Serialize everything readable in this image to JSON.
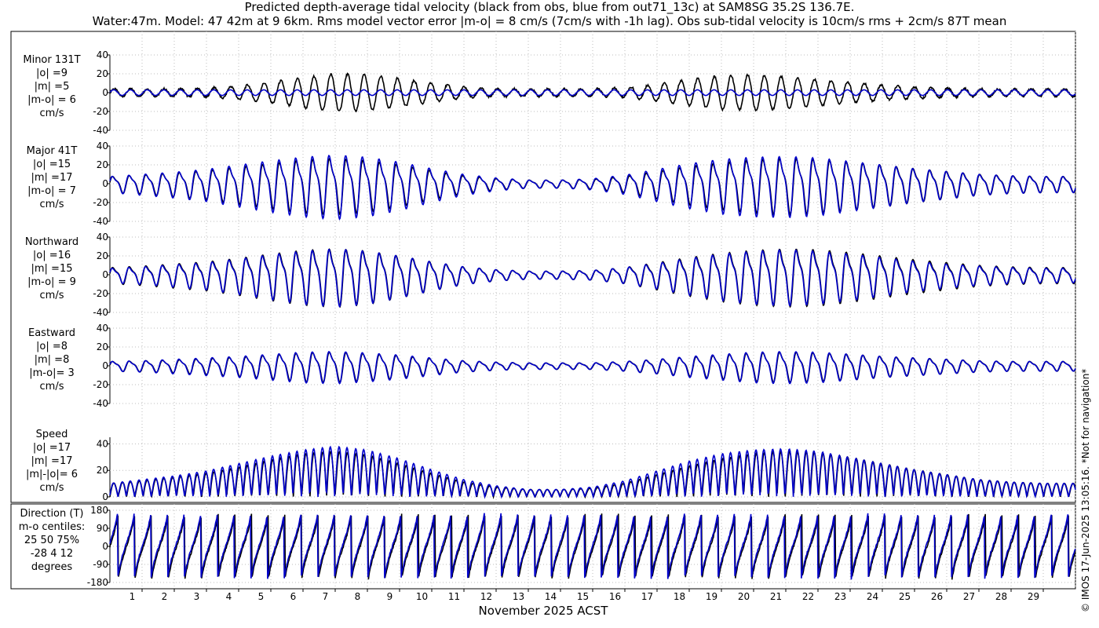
{
  "title_line1": "Predicted depth-average tidal velocity (black from obs, blue from out71_13c) at SAM8SG 35.2S 136.7E.",
  "title_line2": "Water:47m. Model: 47 42m at 9 6km. Rms model vector error |m-o| = 8 cm/s (7cm/s with -1h lag). Obs sub-tidal velocity is 10cm/s rms + 2cm/s 87T mean",
  "footer": "© IMOS 17-Jun-2025 13:05:16. *Not for navigation*",
  "xlabel": "November 2025 ACST",
  "colors": {
    "obs": "#000000",
    "model": "#0000cc",
    "grid": "#bdbdbd"
  },
  "chart_data": [
    {
      "type": "line",
      "panel": "minor",
      "labels": [
        "Minor 131T",
        "|o| =9",
        "|m| =5",
        "|m-o| = 6",
        "cm/s"
      ],
      "yticks": [
        "40",
        "20",
        "0",
        "-20",
        "-40"
      ],
      "ylim": [
        -40,
        40
      ],
      "xlim": [
        0,
        30
      ],
      "x_ticks": [
        "1",
        "2",
        "3",
        "4",
        "5",
        "6",
        "7",
        "8",
        "9",
        "10",
        "11",
        "12",
        "13",
        "14",
        "15",
        "16",
        "17",
        "18",
        "19",
        "20",
        "21",
        "22",
        "23",
        "24",
        "25",
        "26",
        "27",
        "28",
        "29"
      ],
      "series": [
        {
          "name": "obs",
          "amplitude_by_day": [
            4,
            4,
            4,
            5,
            7,
            11,
            16,
            20,
            19,
            15,
            10,
            6,
            4,
            4,
            4,
            4,
            5,
            9,
            14,
            18,
            19,
            17,
            14,
            11,
            8,
            6,
            5,
            4,
            4,
            4
          ]
        },
        {
          "name": "model",
          "amplitude_by_day": [
            3,
            3,
            3,
            3,
            3,
            3,
            3,
            3,
            3,
            3,
            3,
            3,
            3,
            3,
            3,
            3,
            3,
            3,
            3,
            3,
            3,
            3,
            3,
            3,
            3,
            3,
            3,
            3,
            3,
            3
          ]
        }
      ]
    },
    {
      "type": "line",
      "panel": "major",
      "labels": [
        "Major 41T",
        "|o| =15",
        "|m| =17",
        "|m-o| = 7",
        "cm/s"
      ],
      "yticks": [
        "40",
        "20",
        "0",
        "-20",
        "-40"
      ],
      "ylim": [
        -40,
        40
      ],
      "series": [
        {
          "name": "obs",
          "amplitude_by_day": [
            10,
            12,
            15,
            18,
            23,
            28,
            33,
            35,
            32,
            26,
            18,
            11,
            7,
            5,
            5,
            6,
            10,
            17,
            24,
            29,
            33,
            35,
            34,
            30,
            26,
            21,
            17,
            13,
            11,
            10
          ]
        },
        {
          "name": "model",
          "amplitude_by_day": [
            10,
            13,
            16,
            20,
            26,
            32,
            37,
            40,
            37,
            30,
            21,
            13,
            8,
            5,
            5,
            7,
            12,
            20,
            28,
            34,
            37,
            38,
            36,
            31,
            26,
            21,
            17,
            13,
            11,
            10
          ]
        }
      ]
    },
    {
      "type": "line",
      "panel": "northward",
      "labels": [
        "Northward",
        "|o| =16",
        "|m| =15",
        "|m-o| = 9",
        "cm/s"
      ],
      "yticks": [
        "40",
        "20",
        "0",
        "-20",
        "-40"
      ],
      "ylim": [
        -40,
        40
      ],
      "series": [
        {
          "name": "obs",
          "amplitude_by_day": [
            10,
            12,
            15,
            18,
            23,
            29,
            34,
            36,
            33,
            26,
            18,
            11,
            7,
            5,
            5,
            6,
            10,
            17,
            24,
            30,
            34,
            36,
            35,
            31,
            26,
            21,
            17,
            13,
            11,
            10
          ]
        },
        {
          "name": "model",
          "amplitude_by_day": [
            9,
            11,
            14,
            17,
            22,
            28,
            33,
            36,
            33,
            26,
            18,
            11,
            7,
            5,
            5,
            6,
            10,
            16,
            23,
            29,
            33,
            35,
            33,
            29,
            24,
            19,
            15,
            12,
            10,
            9
          ]
        }
      ]
    },
    {
      "type": "line",
      "panel": "eastward",
      "labels": [
        "Eastward",
        "|o| =8",
        "|m| =8",
        "|m-o|= 3",
        "cm/s"
      ],
      "yticks": [
        "40",
        "20",
        "0",
        "-20",
        "-40"
      ],
      "ylim": [
        -40,
        40
      ],
      "series": [
        {
          "name": "obs",
          "amplitude_by_day": [
            6,
            7,
            8,
            10,
            12,
            15,
            18,
            19,
            17,
            14,
            10,
            7,
            5,
            4,
            4,
            4,
            6,
            9,
            12,
            15,
            18,
            19,
            18,
            16,
            13,
            11,
            9,
            7,
            6,
            6
          ]
        },
        {
          "name": "model",
          "amplitude_by_day": [
            6,
            7,
            9,
            11,
            13,
            16,
            19,
            20,
            18,
            15,
            11,
            7,
            5,
            4,
            4,
            4,
            6,
            9,
            13,
            16,
            19,
            20,
            19,
            16,
            13,
            11,
            9,
            7,
            6,
            6
          ]
        }
      ]
    },
    {
      "type": "line",
      "panel": "speed",
      "labels": [
        "Speed",
        "|o| =17",
        "|m| =17",
        "|m|-|o|= 6",
        "cm/s"
      ],
      "yticks": [
        "40",
        "20",
        "0"
      ],
      "ylim": [
        0,
        45
      ],
      "series": [
        {
          "name": "obs",
          "amplitude_by_day": [
            11,
            13,
            16,
            19,
            24,
            30,
            35,
            37,
            34,
            27,
            19,
            12,
            8,
            6,
            6,
            7,
            11,
            18,
            25,
            31,
            35,
            37,
            36,
            32,
            27,
            22,
            18,
            14,
            12,
            11
          ]
        },
        {
          "name": "model",
          "amplitude_by_day": [
            11,
            14,
            17,
            21,
            27,
            33,
            38,
            41,
            38,
            31,
            22,
            14,
            9,
            6,
            6,
            8,
            13,
            21,
            29,
            35,
            38,
            39,
            37,
            32,
            27,
            22,
            18,
            14,
            12,
            11
          ]
        }
      ]
    },
    {
      "type": "line",
      "panel": "direction",
      "labels": [
        "Direction (T)",
        "m-o centiles:",
        "25  50  75%",
        "-28   4  12",
        "degrees"
      ],
      "yticks": [
        "180",
        "90",
        "0",
        "-90",
        "-180"
      ],
      "ylim": [
        -180,
        180
      ],
      "series": [
        {
          "name": "obs",
          "description_values": []
        },
        {
          "name": "model",
          "description_values": []
        }
      ]
    }
  ]
}
